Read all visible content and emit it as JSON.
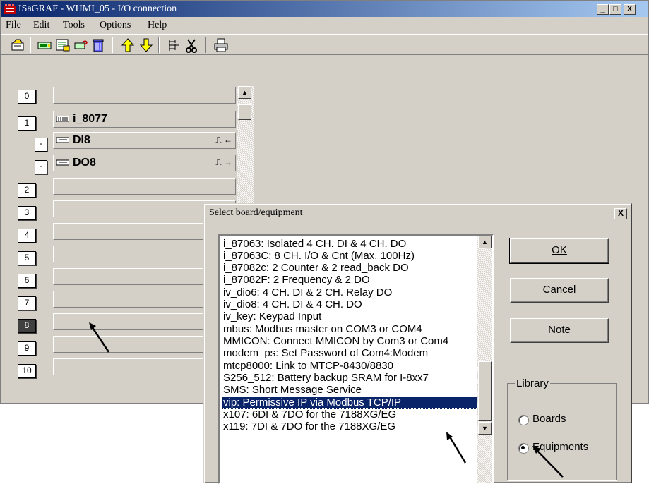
{
  "window": {
    "title": "ISaGRAF - WHMI_05 - I/O connection",
    "controls": {
      "minimize": "_",
      "maximize": "□",
      "close": "X"
    }
  },
  "menu": [
    "File",
    "Edit",
    "Tools",
    "Options",
    "Help"
  ],
  "toolbar": {
    "icons": [
      "open-board-icon",
      "insert-board-icon",
      "board-params-icon",
      "help-board-icon",
      "delete-icon",
      "move-up-icon",
      "move-down-icon",
      "connect-icon",
      "disconnect-icon",
      "print-icon"
    ]
  },
  "rack": {
    "slots": [
      {
        "num": "0",
        "label": ""
      },
      {
        "num": "1",
        "label": "i_8077"
      },
      {
        "num": "-",
        "label": "DI8",
        "arrows": "⎍ ←",
        "sub": true
      },
      {
        "num": "-",
        "label": "DO8",
        "arrows": "⎍ →",
        "sub": true
      },
      {
        "num": "2",
        "label": ""
      },
      {
        "num": "3",
        "label": ""
      },
      {
        "num": "4",
        "label": ""
      },
      {
        "num": "5",
        "label": ""
      },
      {
        "num": "6",
        "label": ""
      },
      {
        "num": "7",
        "label": ""
      },
      {
        "num": "8",
        "label": "",
        "selected": true
      },
      {
        "num": "9",
        "label": ""
      },
      {
        "num": "10",
        "label": ""
      }
    ]
  },
  "dialog": {
    "title": "Select board/equipment",
    "close": "X",
    "items": [
      "i_87063: Isolated 4 CH. DI & 4 CH. DO",
      "i_87063C: 8 CH. I/O  & Cnt (Max. 100Hz)",
      "i_87082c: 2 Counter & 2 read_back DO",
      "i_87082F: 2 Frequency & 2 DO",
      "iv_dio6: 4 CH. DI & 2 CH. Relay DO",
      "iv_dio8: 4 CH. DI & 4 CH. DO",
      "iv_key: Keypad Input",
      "mbus: Modbus master on COM3 or COM4",
      "MMICON: Connect MMICON by Com3 or Com4",
      "modem_ps: Set Password of Com4:Modem_",
      "mtcp8000: Link to MTCP-8430/8830",
      "S256_512: Battery backup SRAM for I-8xx7",
      "SMS: Short Message Service",
      "vip: Permissive IP via Modbus TCP/IP",
      "x107: 6DI & 7DO for the 7188XG/EG",
      "x119: 7DI & 7DO for the 7188XG/EG"
    ],
    "selected_index": 13,
    "buttons": {
      "ok": "OK",
      "cancel": "Cancel",
      "note": "Note"
    },
    "library": {
      "label": "Library",
      "options": [
        "Boards",
        "Equipments"
      ],
      "selected": "Equipments"
    }
  }
}
